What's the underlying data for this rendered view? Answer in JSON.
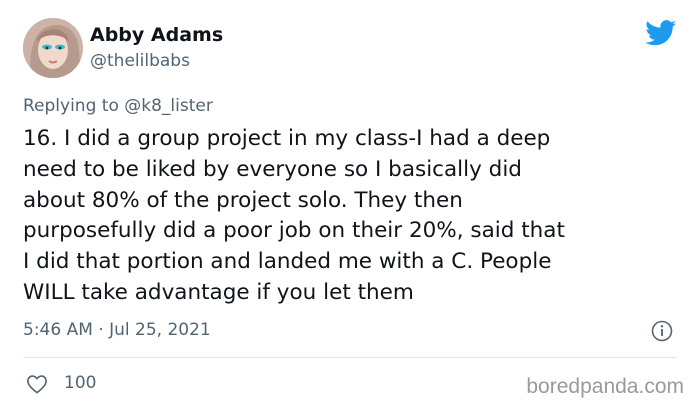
{
  "user": {
    "name": "Abby Adams",
    "handle": "@thelilbabs"
  },
  "reply": {
    "prefix": "Replying to ",
    "mention": "@k8_lister"
  },
  "tweet": {
    "text": "16. I did a group project in my class-I had a deep\nneed to be liked by everyone so I basically did\nabout 80% of the project solo. They then\npurposefully did a poor job on their 20%, said that\nI did that portion and landed me with a C. People\nWILL take advantage if you let them",
    "timestamp": "5:46 AM · Jul 25, 2021",
    "like_count": "100"
  },
  "watermark": "boredpanda.com",
  "icons": {
    "brand": "twitter-bird-icon",
    "info": "info-icon",
    "like": "heart-icon"
  },
  "colors": {
    "twitter_blue": "#1d9bf0",
    "secondary_text": "#536471",
    "primary_text": "#0f1419"
  }
}
